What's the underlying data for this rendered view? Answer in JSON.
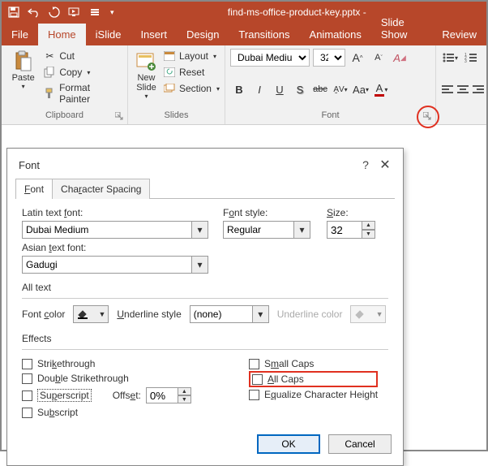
{
  "titlebar": {
    "filename": "find-ms-office-product-key.pptx -"
  },
  "tabs": {
    "file": "File",
    "home": "Home",
    "islide": "iSlide",
    "insert": "Insert",
    "design": "Design",
    "transitions": "Transitions",
    "animations": "Animations",
    "slideshow": "Slide Show",
    "review": "Review"
  },
  "ribbon": {
    "clipboard": {
      "paste": "Paste",
      "cut": "Cut",
      "copy": "Copy",
      "format_painter": "Format Painter",
      "label": "Clipboard"
    },
    "slides": {
      "new_slide": "New\nSlide",
      "layout": "Layout",
      "reset": "Reset",
      "section": "Section",
      "label": "Slides"
    },
    "font": {
      "name": "Dubai Medium",
      "size": "32",
      "label": "Font",
      "bold": "B",
      "italic": "I",
      "underline": "U",
      "shadow": "S",
      "strike": "abc",
      "spacing": "AV",
      "case": "Aa",
      "color": "A"
    },
    "paragraph": {}
  },
  "dialog": {
    "title": "Font",
    "tabs": {
      "font": "Font",
      "spacing": "Character Spacing"
    },
    "latin_label": "Latin text font:",
    "latin_value": "Dubai Medium",
    "style_label": "Font style:",
    "style_value": "Regular",
    "size_label": "Size:",
    "size_value": "32",
    "asian_label": "Asian text font:",
    "asian_value": "Gadugi",
    "all_text": "All text",
    "font_color_label": "Font color",
    "underline_style_label": "Underline style",
    "underline_style_value": "(none)",
    "underline_color_label": "Underline color",
    "effects_label": "Effects",
    "strike": "Strikethrough",
    "dstrike": "Double Strikethrough",
    "superscript": "Superscript",
    "subscript": "Subscript",
    "offset_label": "Offset:",
    "offset_value": "0%",
    "small_caps": "Small Caps",
    "all_caps": "All Caps",
    "equalize": "Equalize Character Height",
    "ok": "OK",
    "cancel": "Cancel"
  }
}
